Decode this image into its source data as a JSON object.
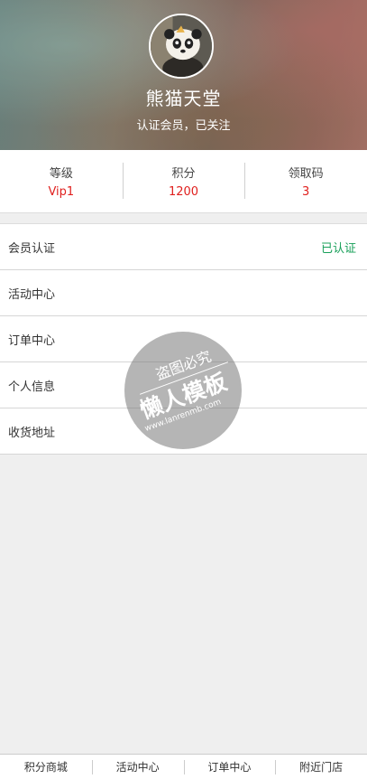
{
  "profile": {
    "username": "熊猫天堂",
    "subtitle": "认证会员，已关注"
  },
  "stats": [
    {
      "label": "等级",
      "value": "Vip1"
    },
    {
      "label": "积分",
      "value": "1200"
    },
    {
      "label": "领取码",
      "value": "3"
    }
  ],
  "menu": [
    {
      "label": "会员认证",
      "status": "已认证"
    },
    {
      "label": "活动中心",
      "status": ""
    },
    {
      "label": "订单中心",
      "status": ""
    },
    {
      "label": "个人信息",
      "status": ""
    },
    {
      "label": "收货地址",
      "status": ""
    }
  ],
  "watermark": {
    "top": "盗图必究",
    "main": "懒人模板",
    "url": "www.lanrenmb.com"
  },
  "tabbar": [
    {
      "label": "积分商城"
    },
    {
      "label": "活动中心"
    },
    {
      "label": "订单中心"
    },
    {
      "label": "附近门店"
    }
  ],
  "colors": {
    "accent_red": "#e0201e",
    "verified_green": "#19a05a"
  }
}
